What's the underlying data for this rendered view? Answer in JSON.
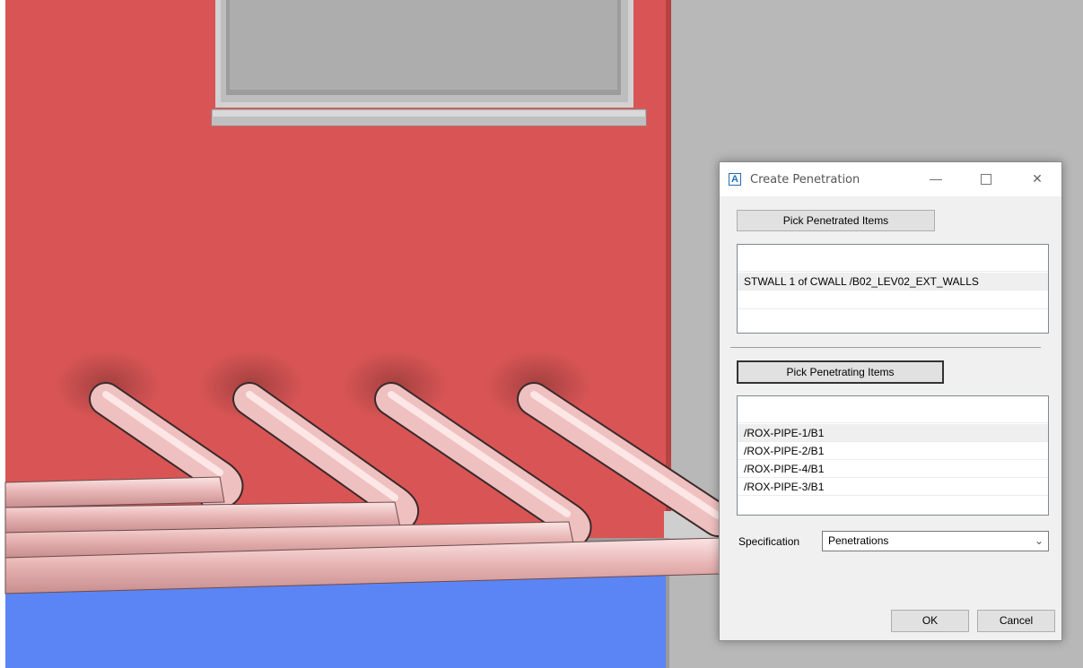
{
  "dialog": {
    "title": "Create Penetration",
    "icon": "aveva-app-icon",
    "window_controls": {
      "minimize": "—",
      "close": "✕"
    },
    "pick_penetrated_label": "Pick Penetrated Items",
    "penetrated_items": [
      "",
      "STWALL 1 of CWALL /B02_LEV02_EXT_WALLS",
      ""
    ],
    "pick_penetrating_label": "Pick Penetrating Items",
    "penetrating_items": [
      "",
      "/ROX-PIPE-1/B1",
      "/ROX-PIPE-2/B1",
      "/ROX-PIPE-4/B1",
      "/ROX-PIPE-3/B1",
      ""
    ],
    "specification_label": "Specification",
    "specification_value": "Penetrations",
    "ok_label": "OK",
    "cancel_label": "Cancel"
  },
  "colors": {
    "wall": "#d95555",
    "floor_slab": "#5b85f5",
    "background": "#b3b3b3",
    "pipe": "#f0c2c2"
  }
}
